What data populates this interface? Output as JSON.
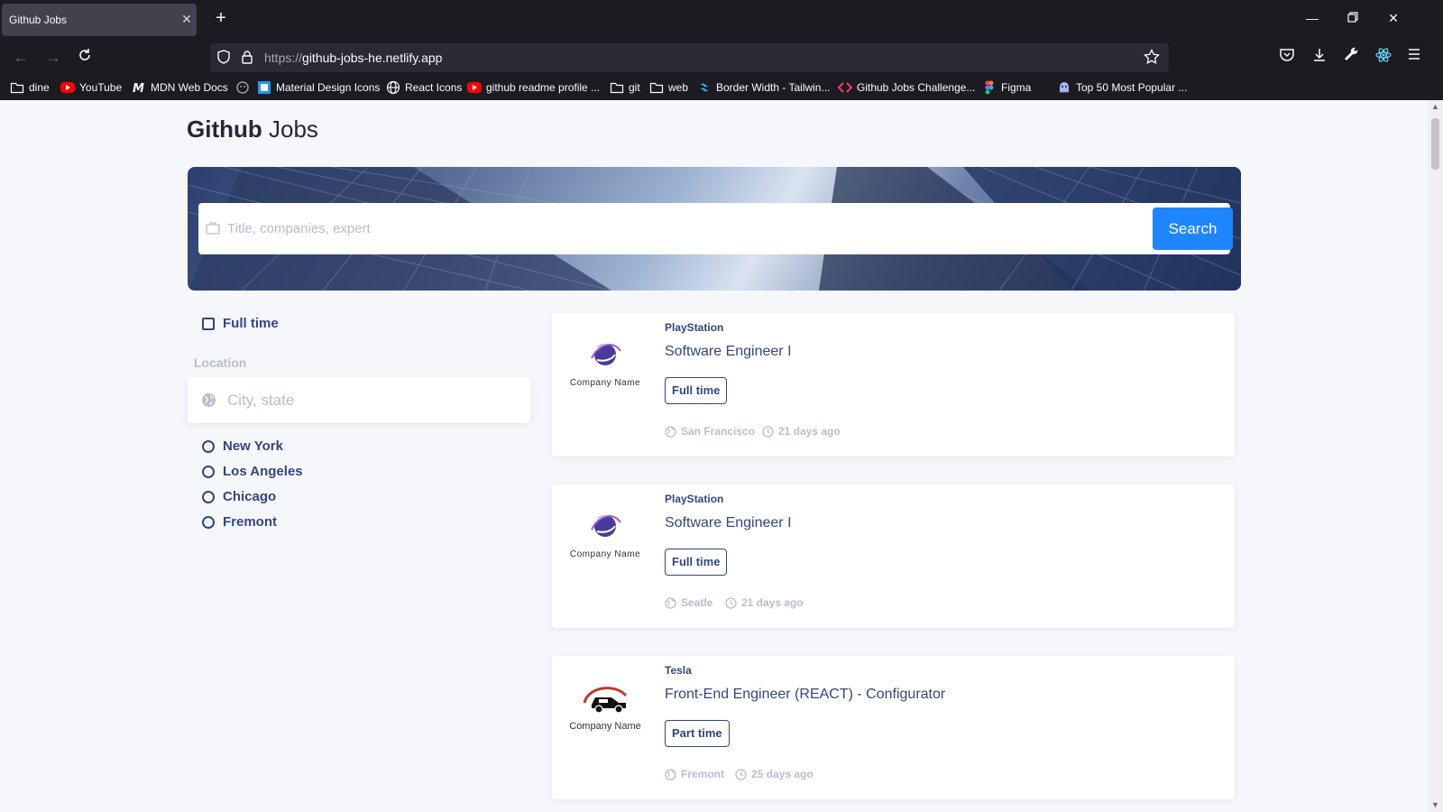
{
  "browser": {
    "tab_title": "Github Jobs",
    "url_scheme": "https://",
    "url_host": "github-jobs-he.netlify.app",
    "bookmarks": [
      {
        "label": "dine",
        "icon": "folder-icon"
      },
      {
        "label": "YouTube",
        "icon": "youtube-icon"
      },
      {
        "label": "MDN Web Docs",
        "icon": "mdn-icon"
      },
      {
        "label": "",
        "icon": "octopus-icon"
      },
      {
        "label": "Material Design Icons",
        "icon": "mdi-icon"
      },
      {
        "label": "React Icons",
        "icon": "globe-icon"
      },
      {
        "label": "github readme profile ...",
        "icon": "youtube-icon"
      },
      {
        "label": "git",
        "icon": "folder-icon"
      },
      {
        "label": "web",
        "icon": "folder-icon"
      },
      {
        "label": "Border Width - Tailwin...",
        "icon": "tailwind-icon"
      },
      {
        "label": "Github Jobs Challenge...",
        "icon": "devchallenges-icon"
      },
      {
        "label": "Figma",
        "icon": "figma-icon"
      },
      {
        "label": "Top 50 Most Popular ...",
        "icon": "ghost-icon"
      }
    ]
  },
  "header": {
    "brand_bold": "Github",
    "brand_light": "Jobs"
  },
  "search": {
    "placeholder": "Title, companies, expert",
    "button_label": "Search"
  },
  "filters": {
    "full_time_label": "Full time",
    "location_title": "Location",
    "location_placeholder": "City, state",
    "cities": [
      "New York",
      "Los Angeles",
      "Chicago",
      "Fremont"
    ]
  },
  "jobs": [
    {
      "company": "PlayStation",
      "title": "Software Engineer I",
      "type": "Full time",
      "location": "San Francisco",
      "posted": "21 days ago",
      "logo_caption": "Company Name"
    },
    {
      "company": "PlayStation",
      "title": "Software Engineer I",
      "type": "Full time",
      "location": "Seatle",
      "posted": "21 days ago",
      "logo_caption": "Company Name"
    },
    {
      "company": "Tesla",
      "title": "Front-End Engineer (REACT) - Configurator",
      "type": "Part time",
      "location": "Fremont",
      "posted": "25 days ago",
      "logo_caption": "Company Name"
    }
  ],
  "colors": {
    "accent": "#1e86ff",
    "text_primary": "#334680",
    "text_muted": "#b9bdcf",
    "page_bg": "#f6f7fb"
  }
}
